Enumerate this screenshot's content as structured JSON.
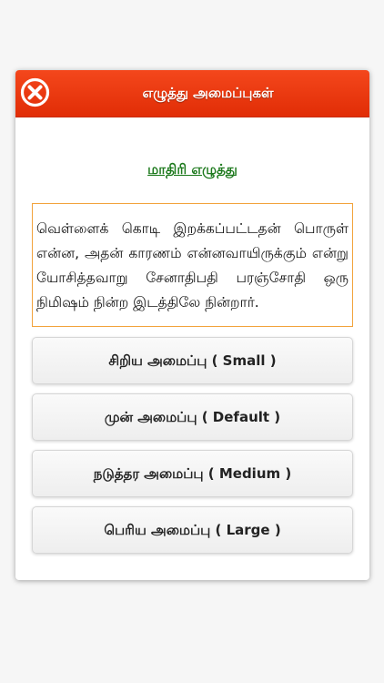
{
  "dialog": {
    "title": "எழுத்து அமைப்புகள்",
    "close_icon": "close-circle-icon",
    "header_color": "#e8350c"
  },
  "sample": {
    "link_label": "மாதிரி எழுத்து",
    "text": "வெள்ளைக் கொடி இறக்கப்பட்டதன் பொருள் என்ன, அதன் காரணம் என்னவாயிருக்கும் என்று யோசித்தவாறு சேனாதிபதி பரஞ்சோதி ஒரு நிமிஷம் நின்ற இடத்திலே நின்றார்."
  },
  "size_options": [
    {
      "label": "சிறிய அமைப்பு ( Small )"
    },
    {
      "label": "முன் அமைப்பு ( Default )"
    },
    {
      "label": "நடுத்தர அமைப்பு ( Medium )"
    },
    {
      "label": "பெரிய அமைப்பு ( Large )"
    }
  ]
}
